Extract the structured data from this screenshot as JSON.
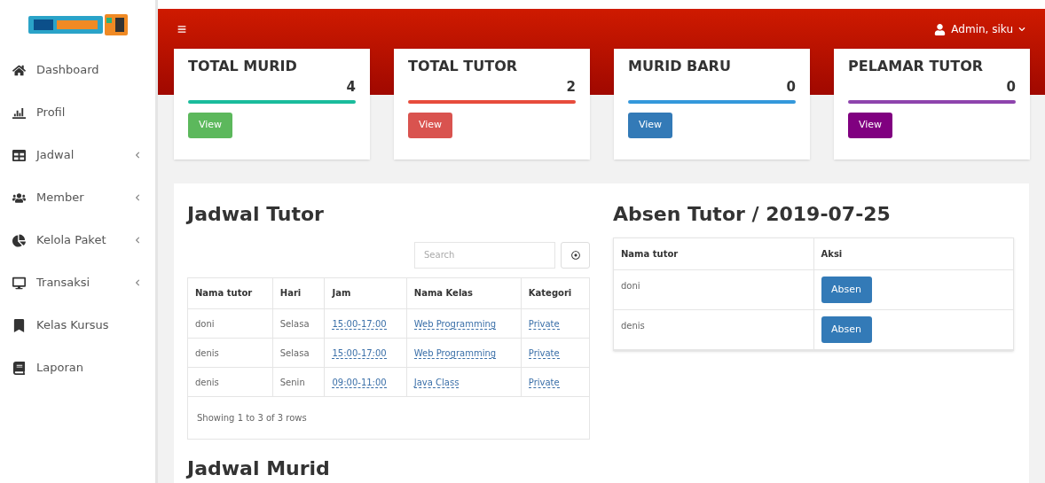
{
  "sidebar": {
    "items": [
      {
        "kind": "home",
        "label": "Dashboard",
        "has_submenu": false
      },
      {
        "kind": "chart",
        "label": "Profil",
        "has_submenu": false
      },
      {
        "kind": "table",
        "label": "Jadwal",
        "has_submenu": true
      },
      {
        "kind": "users",
        "label": "Member",
        "has_submenu": true
      },
      {
        "kind": "pie",
        "label": "Kelola Paket",
        "has_submenu": true
      },
      {
        "kind": "desktop",
        "label": "Transaksi",
        "has_submenu": true
      },
      {
        "kind": "bookmark",
        "label": "Kelas Kursus",
        "has_submenu": false
      },
      {
        "kind": "book",
        "label": "Laporan",
        "has_submenu": false
      }
    ]
  },
  "header": {
    "user": "Admin, siku"
  },
  "cards": [
    {
      "title": "TOTAL MURID",
      "value": "4",
      "color": "#1abc9c",
      "button": {
        "label": "View",
        "kind": "success"
      }
    },
    {
      "title": "TOTAL TUTOR",
      "value": "2",
      "color": "#e74c3c",
      "button": {
        "label": "View",
        "kind": "danger"
      }
    },
    {
      "title": "MURID BARU",
      "value": "0",
      "color": "#3498db",
      "button": {
        "label": "View",
        "kind": "primary"
      }
    },
    {
      "title": "PELAMAR TUTOR",
      "value": "0",
      "color": "#8e44ad",
      "button": {
        "label": "View",
        "kind": "purple"
      }
    }
  ],
  "jadwal_tutor": {
    "title": "Jadwal Tutor",
    "search": {
      "placeholder": "Search"
    },
    "columns": [
      {
        "label": "Nama tutor",
        "kind": "text"
      },
      {
        "label": "Hari",
        "kind": "text"
      },
      {
        "label": "Jam",
        "kind": "link"
      },
      {
        "label": "Nama Kelas",
        "kind": "link"
      },
      {
        "label": "Kategori",
        "kind": "link"
      }
    ],
    "rows": [
      [
        "doni",
        "Selasa",
        "15:00-17:00",
        "Web Programming",
        "Private"
      ],
      [
        "denis",
        "Selasa",
        "15:00-17:00",
        "Web Programming",
        "Private"
      ],
      [
        "denis",
        "Senin",
        "09:00-11:00",
        "Java Class",
        "Private"
      ]
    ],
    "footer": "Showing 1 to 3 of 3 rows"
  },
  "absen_tutor": {
    "title": "Absen Tutor / 2019-07-25",
    "columns": [
      "Nama tutor",
      "Aksi"
    ],
    "rows": [
      {
        "name": "doni",
        "button": "Absen"
      },
      {
        "name": "denis",
        "button": "Absen"
      }
    ]
  },
  "jadwal_murid": {
    "title": "Jadwal Murid"
  }
}
